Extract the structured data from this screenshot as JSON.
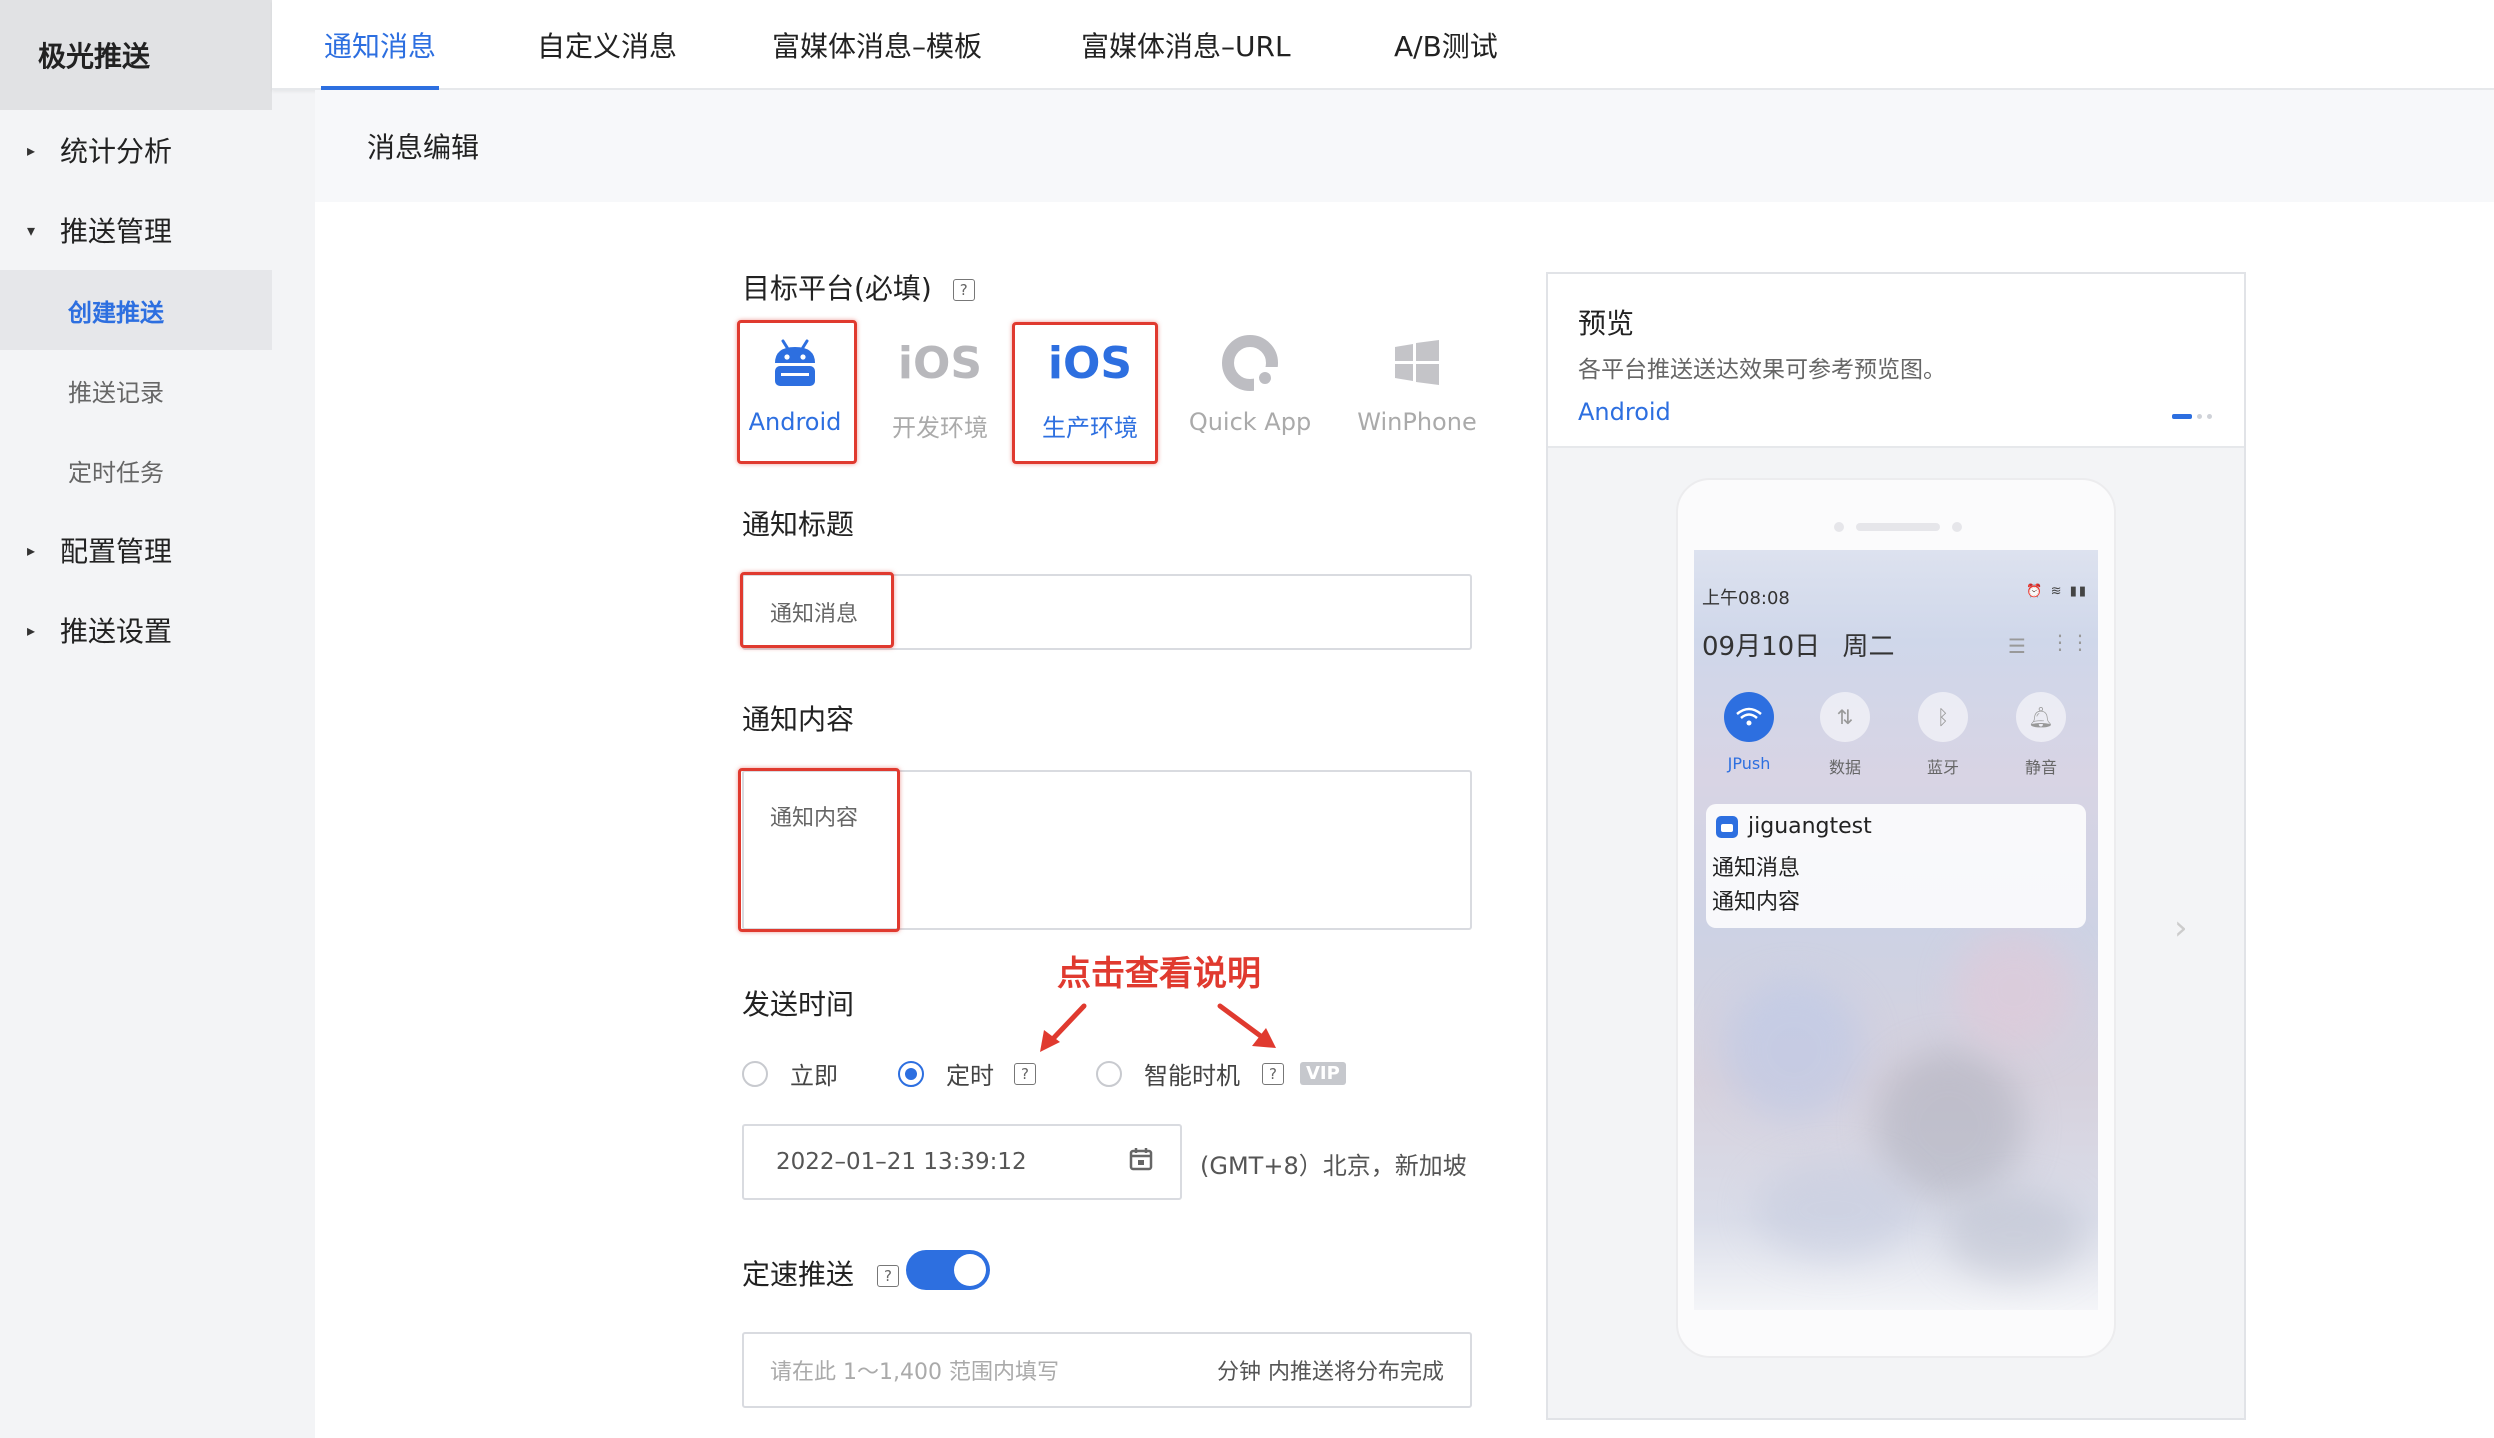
{
  "brand": "极光推送",
  "sidebar": {
    "groups": [
      {
        "label": "统计分析",
        "expanded": false
      },
      {
        "label": "推送管理",
        "expanded": true
      },
      {
        "label": "配置管理",
        "expanded": false
      },
      {
        "label": "推送设置",
        "expanded": false
      }
    ],
    "subitems": [
      "创建推送",
      "推送记录",
      "定时任务"
    ],
    "active_sub": "创建推送"
  },
  "tabs": [
    "通知消息",
    "自定义消息",
    "富媒体消息–模板",
    "富媒体消息–URL",
    "A/B测试"
  ],
  "active_tab": "通知消息",
  "section_title": "消息编辑",
  "form": {
    "platform_label": "目标平台(必填)",
    "platforms": [
      {
        "icon": "android-icon",
        "label": "Android",
        "selected": true
      },
      {
        "icon_text": "iOS",
        "label": "开发环境",
        "selected": false
      },
      {
        "icon_text": "iOS",
        "label": "生产环境",
        "selected": true
      },
      {
        "icon": "quickapp-icon",
        "label": "Quick App",
        "selected": false
      },
      {
        "icon": "windows-icon",
        "label": "WinPhone",
        "selected": false
      }
    ],
    "title_label": "通知标题",
    "title_value": "通知消息",
    "content_label": "通知内容",
    "content_value": "通知内容",
    "send_time_label": "发送时间",
    "send_options": [
      {
        "label": "立即",
        "selected": false
      },
      {
        "label": "定时",
        "selected": true
      },
      {
        "label": "智能时机",
        "selected": false,
        "badge": "VIP"
      }
    ],
    "datetime_value": "2022–01–21 13:39:12",
    "timezone": "(GMT+8）北京，新加坡",
    "rate_label": "定速推送",
    "rate_enabled": true,
    "rate_placeholder": "请在此 1～1,400 范围内填写",
    "rate_suffix": "分钟 内推送将分布完成"
  },
  "annotation": "点击查看说明",
  "preview": {
    "title": "预览",
    "desc": "各平台推送送达效果可参考预览图。",
    "platform": "Android",
    "phone": {
      "time": "上午08:08",
      "date": "09月10日",
      "weekday": "周二",
      "tiles": [
        "JPush",
        "数据",
        "蓝牙",
        "静音"
      ],
      "app_name": "jiguangtest",
      "notif_title": "通知消息",
      "notif_body": "通知内容"
    }
  },
  "colors": {
    "accent": "#2d6fe0",
    "annotation": "#e03a2f",
    "sidebar_bg": "#f3f4f6",
    "brand_bg": "#e1e2e4"
  }
}
